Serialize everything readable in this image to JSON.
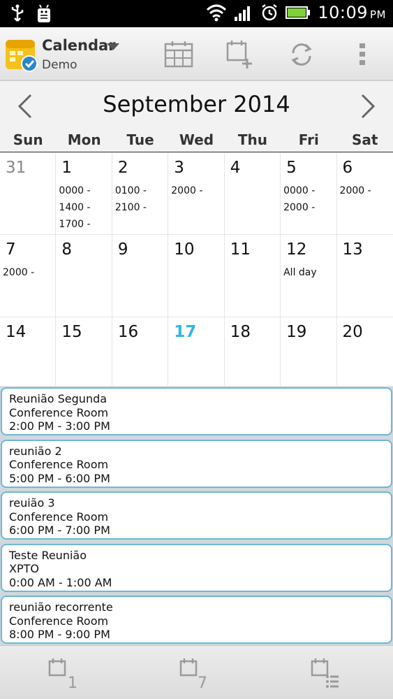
{
  "status_bar": {
    "time": "10:09",
    "ampm": "PM"
  },
  "action_bar": {
    "title": "Calendar",
    "subtitle": "Demo"
  },
  "month": {
    "title": "September 2014"
  },
  "weekdays": [
    "Sun",
    "Mon",
    "Tue",
    "Wed",
    "Thu",
    "Fri",
    "Sat"
  ],
  "weeks": [
    [
      {
        "day": "31",
        "dim": true,
        "events": []
      },
      {
        "day": "1",
        "events": [
          "0000 -",
          "1400 -",
          "1700 -"
        ]
      },
      {
        "day": "2",
        "events": [
          "0100 -",
          "2100 -"
        ]
      },
      {
        "day": "3",
        "events": [
          "2000 -"
        ]
      },
      {
        "day": "4",
        "events": []
      },
      {
        "day": "5",
        "events": [
          "0000 -",
          "2000 -"
        ]
      },
      {
        "day": "6",
        "events": [
          "2000 -"
        ]
      }
    ],
    [
      {
        "day": "7",
        "events": [
          "2000 -"
        ]
      },
      {
        "day": "8",
        "events": []
      },
      {
        "day": "9",
        "events": []
      },
      {
        "day": "10",
        "events": []
      },
      {
        "day": "11",
        "events": []
      },
      {
        "day": "12",
        "events": [
          "All day"
        ]
      },
      {
        "day": "13",
        "events": []
      }
    ],
    [
      {
        "day": "14",
        "events": []
      },
      {
        "day": "15",
        "events": []
      },
      {
        "day": "16",
        "events": []
      },
      {
        "day": "17",
        "today": true,
        "events": []
      },
      {
        "day": "18",
        "events": []
      },
      {
        "day": "19",
        "events": []
      },
      {
        "day": "20",
        "events": []
      }
    ]
  ],
  "agenda": [
    {
      "title": "Reunião Segunda",
      "location": "Conference Room",
      "time": "2:00 PM - 3:00 PM"
    },
    {
      "title": "reunião 2",
      "location": "Conference Room",
      "time": "5:00 PM - 6:00 PM"
    },
    {
      "title": "reuião 3",
      "location": "Conference Room",
      "time": "6:00 PM - 7:00 PM"
    },
    {
      "title": "Teste Reunião",
      "location": "XPTO",
      "time": "0:00 AM - 1:00 AM"
    },
    {
      "title": "reunião recorrente",
      "location": "Conference Room",
      "time": "8:00 PM - 9:00 PM"
    }
  ],
  "colors": {
    "today": "#33b5e5",
    "card_border": "#6fb7d6",
    "battery": "#7fd13b"
  },
  "bottom_bar": {
    "day_view_number": "1",
    "week_view_number": "7"
  }
}
